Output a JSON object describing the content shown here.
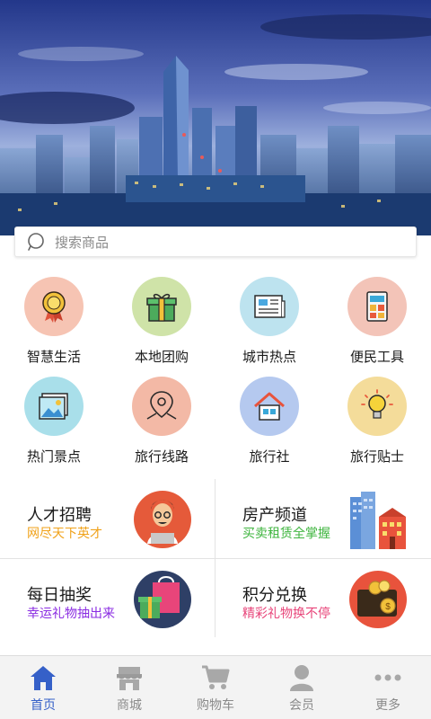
{
  "search": {
    "placeholder": "搜索商品"
  },
  "categories": [
    {
      "label": "智慧生活",
      "icon": "medal-icon",
      "bg": "#f6c4b3"
    },
    {
      "label": "本地团购",
      "icon": "gift-icon",
      "bg": "#cfe3a8"
    },
    {
      "label": "城市热点",
      "icon": "news-icon",
      "bg": "#bde3ef"
    },
    {
      "label": "便民工具",
      "icon": "calculator-icon",
      "bg": "#f3c4b8"
    },
    {
      "label": "热门景点",
      "icon": "picture-icon",
      "bg": "#a9dfea"
    },
    {
      "label": "旅行线路",
      "icon": "map-pin-icon",
      "bg": "#f3b9a6"
    },
    {
      "label": "旅行社",
      "icon": "house-icon",
      "bg": "#b5c9ef"
    },
    {
      "label": "旅行贴士",
      "icon": "lightbulb-icon",
      "bg": "#f4dc9a"
    }
  ],
  "cards": [
    {
      "title": "人才招聘",
      "subtitle": "网尽天下英才",
      "color": "#f0a21a",
      "icon": "recruiter-avatar-icon"
    },
    {
      "title": "房产频道",
      "subtitle": "买卖租赁全掌握",
      "color": "#3fb53f",
      "icon": "buildings-icon"
    },
    {
      "title": "每日抽奖",
      "subtitle": "幸运礼物抽出来",
      "color": "#8a2be2",
      "icon": "gift-bag-icon"
    },
    {
      "title": "积分兑换",
      "subtitle": "精彩礼物换不停",
      "color": "#e8457a",
      "icon": "wallet-coins-icon"
    }
  ],
  "tabs": [
    {
      "label": "首页",
      "icon": "home-icon",
      "active": true
    },
    {
      "label": "商城",
      "icon": "store-icon",
      "active": false
    },
    {
      "label": "购物车",
      "icon": "cart-icon",
      "active": false
    },
    {
      "label": "会员",
      "icon": "member-icon",
      "active": false
    },
    {
      "label": "更多",
      "icon": "more-icon",
      "active": false
    }
  ],
  "colors": {
    "accent": "#3560c8",
    "inactive": "#8a8a8a"
  }
}
